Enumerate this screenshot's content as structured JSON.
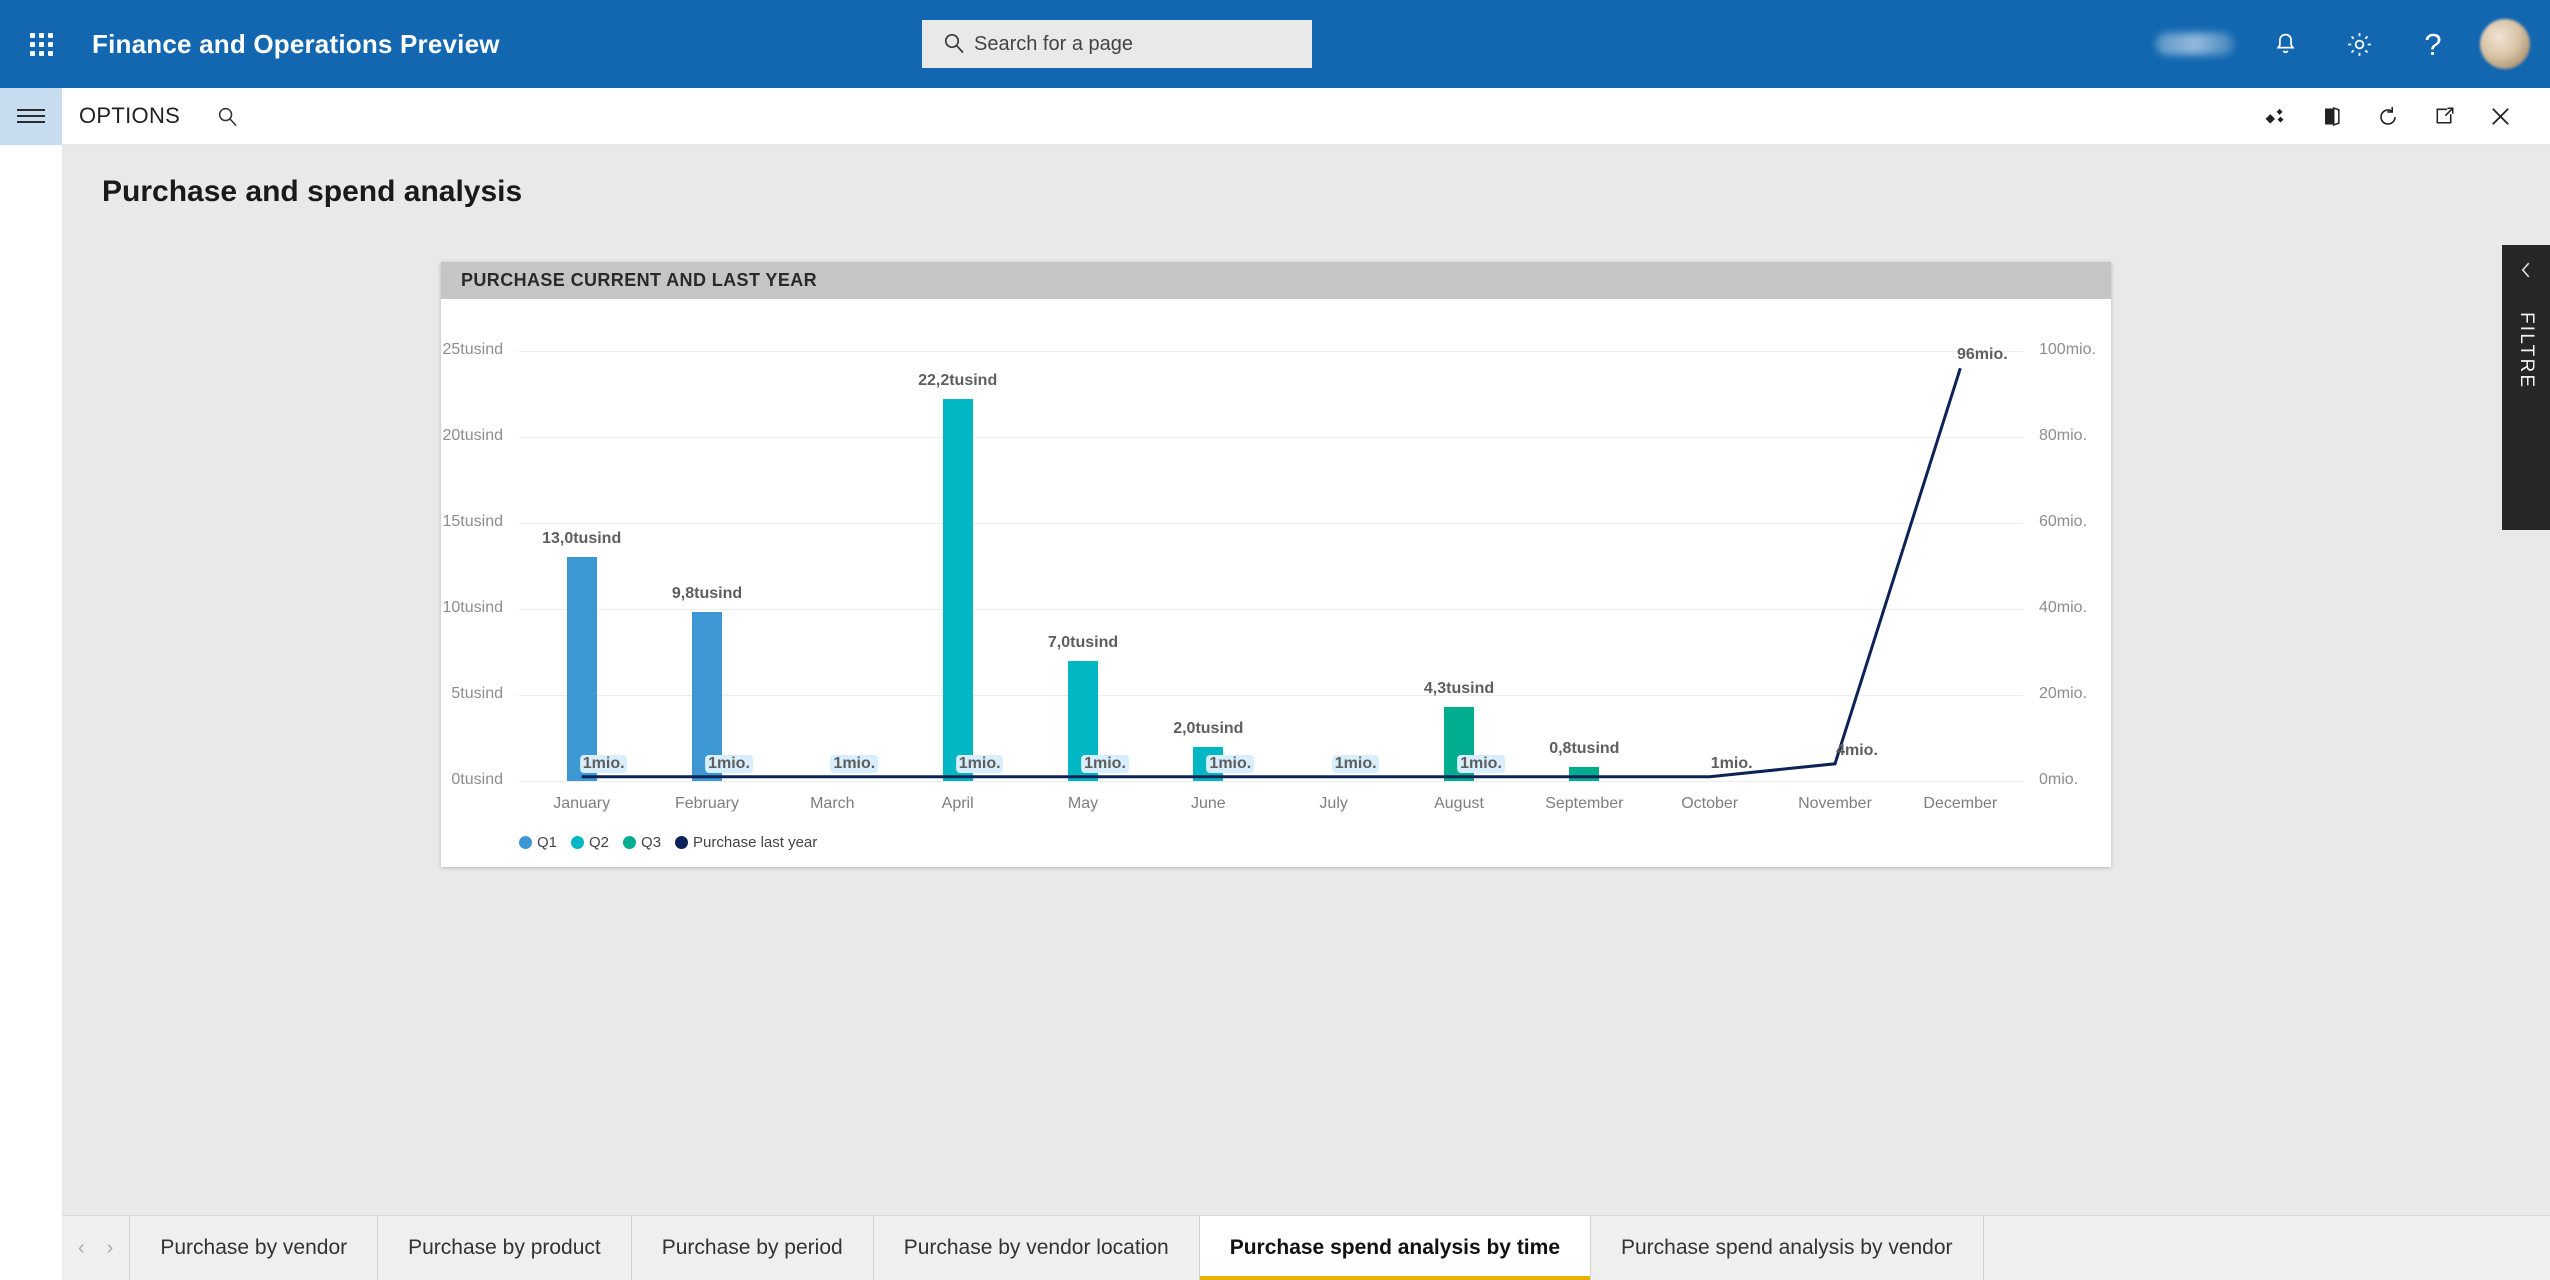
{
  "topbar": {
    "app_title": "Finance and Operations Preview",
    "waffle_icon": "app-launcher-icon",
    "search": {
      "placeholder": "Search for a page",
      "value": "",
      "icon": "search-icon"
    },
    "icons": [
      {
        "name": "blurred-text-icon",
        "glyph": ""
      },
      {
        "name": "bell-icon",
        "glyph": "⼉"
      },
      {
        "name": "gear-icon",
        "glyph": "⚙"
      },
      {
        "name": "help-icon",
        "glyph": "?"
      }
    ],
    "avatar_label": "avatar"
  },
  "commandbar": {
    "hamburger_label": "navigation-menu",
    "options_label": "OPTIONS",
    "search_icon": "search-icon",
    "right_icons": [
      {
        "name": "personalize-icon",
        "title": "Personalize"
      },
      {
        "name": "office-app-icon",
        "title": "Open in Office"
      },
      {
        "name": "refresh-icon",
        "title": "Refresh"
      },
      {
        "name": "popout-icon",
        "title": "Open in new window"
      },
      {
        "name": "close-icon",
        "title": "Close"
      }
    ]
  },
  "page": {
    "title": "Purchase and spend analysis"
  },
  "card": {
    "header": "PURCHASE CURRENT AND LAST YEAR"
  },
  "filter_pane": {
    "label": "FILTRE",
    "collapse_icon": "chevron-left-icon"
  },
  "tabs": {
    "prev_arrow": "‹",
    "next_arrow": "›",
    "items": [
      {
        "label": "Purchase by vendor",
        "active": false
      },
      {
        "label": "Purchase by product",
        "active": false
      },
      {
        "label": "Purchase by period",
        "active": false
      },
      {
        "label": "Purchase by vendor location",
        "active": false
      },
      {
        "label": "Purchase spend analysis by time",
        "active": true
      },
      {
        "label": "Purchase spend analysis by vendor",
        "active": false
      }
    ]
  },
  "chart_data": {
    "type": "bar",
    "title": "PURCHASE CURRENT AND LAST YEAR",
    "xlabel": "",
    "ylabel": "",
    "grid": true,
    "legend_position": "bottom-left",
    "categories": [
      "January",
      "February",
      "March",
      "April",
      "May",
      "June",
      "July",
      "August",
      "September",
      "October",
      "November",
      "December"
    ],
    "left_axis": {
      "label": "",
      "ticks": [
        "0tusind",
        "5tusind",
        "10tusind",
        "15tusind",
        "20tusind",
        "25tusind"
      ],
      "tick_values": [
        0,
        5000,
        10000,
        15000,
        20000,
        25000
      ],
      "ylim": [
        0,
        25000
      ]
    },
    "right_axis": {
      "label": "",
      "ticks": [
        "0mio.",
        "20mio.",
        "40mio.",
        "60mio.",
        "80mio.",
        "100mio."
      ],
      "tick_values": [
        0,
        20000000,
        40000000,
        60000000,
        80000000,
        100000000
      ],
      "ylim": [
        0,
        100000000
      ]
    },
    "colors": {
      "Q1": "#3C97D3",
      "Q2": "#00B7C3",
      "Q3": "#00AD8E",
      "Purchase last year": "#0D2357"
    },
    "series": [
      {
        "name": "Q1",
        "type": "bar",
        "axis": "left",
        "color": "#3C97D3",
        "values": [
          13000,
          9800,
          0,
          null,
          null,
          null,
          null,
          null,
          null,
          null,
          null,
          null
        ],
        "labels": [
          "13,0tusind",
          "9,8tusind",
          "",
          "",
          "",
          "",
          "",
          "",
          "",
          "",
          "",
          ""
        ]
      },
      {
        "name": "Q2",
        "type": "bar",
        "axis": "left",
        "color": "#00B7C3",
        "values": [
          null,
          null,
          null,
          22200,
          7000,
          2000,
          0,
          null,
          null,
          null,
          null,
          null
        ],
        "labels": [
          "",
          "",
          "",
          "22,2tusind",
          "7,0tusind",
          "2,0tusind",
          "",
          "",
          "",
          "",
          "",
          ""
        ]
      },
      {
        "name": "Q3",
        "type": "bar",
        "axis": "left",
        "color": "#00AD8E",
        "values": [
          null,
          null,
          null,
          null,
          null,
          null,
          null,
          4300,
          800,
          0,
          null,
          null
        ],
        "labels": [
          "",
          "",
          "",
          "",
          "",
          "",
          "",
          "4,3tusind",
          "0,8tusind",
          "",
          "",
          ""
        ]
      },
      {
        "name": "Purchase last year",
        "type": "line",
        "axis": "right",
        "color": "#0D2357",
        "values": [
          1000000,
          1000000,
          1000000,
          1000000,
          1000000,
          1000000,
          1000000,
          1000000,
          1000000,
          1000000,
          4000000,
          96000000
        ],
        "labels": [
          "1mio.",
          "1mio.",
          "1mio.",
          "1mio.",
          "1mio.",
          "1mio.",
          "1mio.",
          "1mio.",
          "",
          "1mio.",
          "4mio.",
          "96mio."
        ]
      }
    ],
    "legend": [
      {
        "label": "Q1",
        "color": "#3C97D3"
      },
      {
        "label": "Q2",
        "color": "#00B7C3"
      },
      {
        "label": "Q3",
        "color": "#00AD8E"
      },
      {
        "label": "Purchase last year",
        "color": "#0D2357"
      }
    ]
  }
}
